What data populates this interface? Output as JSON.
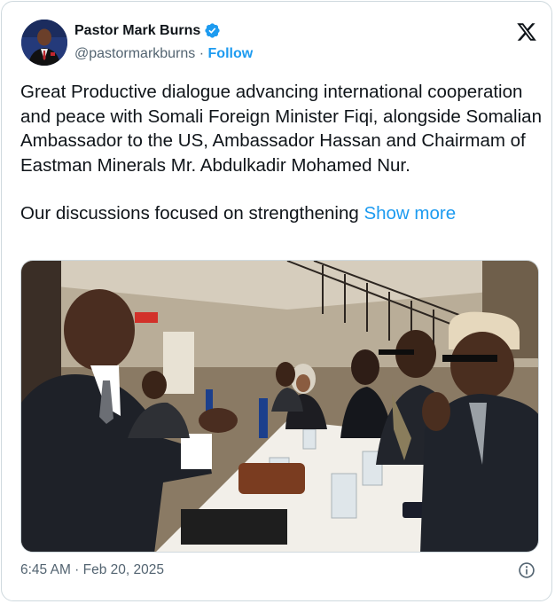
{
  "author": {
    "display_name": "Pastor Mark Burns",
    "handle": "@pastormarkburns",
    "separator": " · ",
    "follow_label": "Follow",
    "verified_color": "#1d9bf0"
  },
  "post": {
    "paragraph_1": "Great Productive dialogue advancing international cooperation and peace with Somali Foreign Minister Fiqi, alongside Somalian  Ambassador to the US, Ambassador Hassan and Chairmam of Eastman Minerals Mr. Abdulkadir Mohamed Nur.",
    "paragraph_2": "Our discussions focused on strengthening ",
    "show_more_label": "Show more",
    "timestamp": "6:45 AM · Feb 20, 2025"
  },
  "icons": {
    "platform_logo": "x-logo-icon",
    "verified": "verified-badge-icon",
    "info": "info-icon"
  },
  "colors": {
    "link": "#1d9bf0",
    "text": "#0f1419",
    "secondary": "#536471",
    "border": "#cfd9de"
  }
}
